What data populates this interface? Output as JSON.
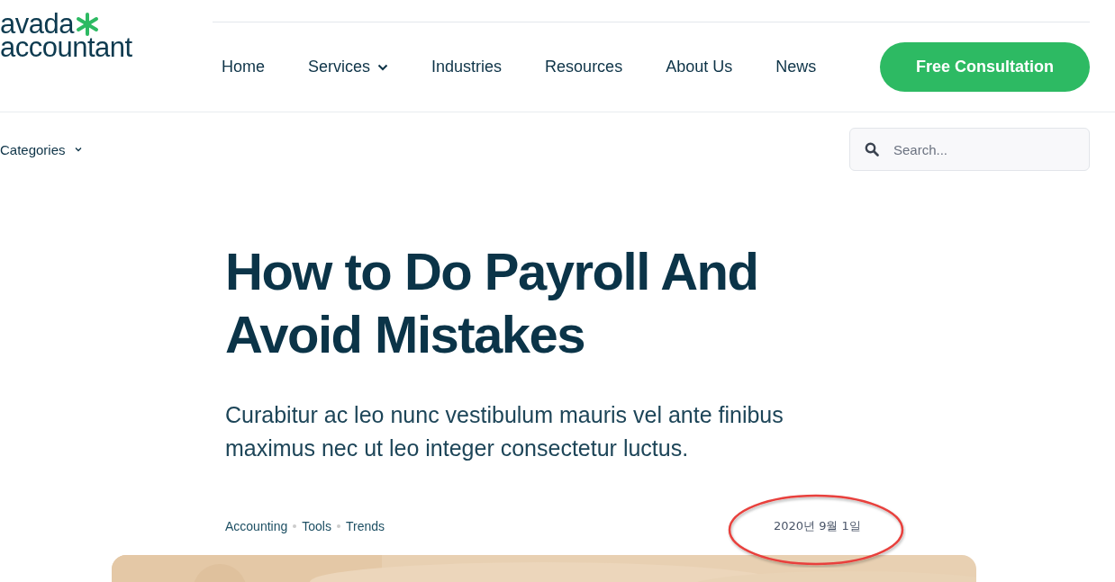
{
  "logo": {
    "line_1": "avada",
    "line_2": "accountant"
  },
  "nav": {
    "items": [
      {
        "label": "Home",
        "has_dropdown": false
      },
      {
        "label": "Services",
        "has_dropdown": true
      },
      {
        "label": "Industries",
        "has_dropdown": false
      },
      {
        "label": "Resources",
        "has_dropdown": false
      },
      {
        "label": "About Us",
        "has_dropdown": false
      },
      {
        "label": "News",
        "has_dropdown": false
      }
    ],
    "cta": "Free Consultation"
  },
  "filter_bar": {
    "categories": "Categories",
    "search": {
      "placeholder": "Search..."
    }
  },
  "article": {
    "title": "How to Do Payroll And Avoid Mistakes",
    "subtitle": "Curabitur ac leo nunc vestibulum mauris vel ante finibus maximus nec ut leo integer consectetur luctus.",
    "tags": [
      "Accounting",
      "Tools",
      "Trends"
    ],
    "date": "2020년 9월 1일",
    "date_highlighted": true
  }
}
